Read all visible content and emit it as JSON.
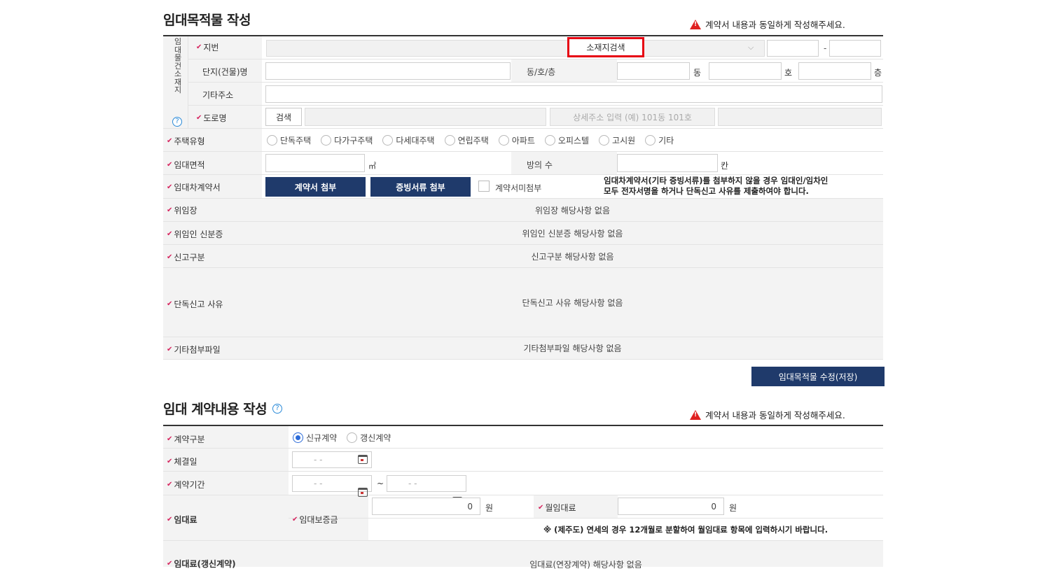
{
  "section1": {
    "title": "임대목적물 작성",
    "warning": "계약서 내용과 동일하게 작성해주세요.",
    "vertical_label": [
      "임",
      "대",
      "물",
      "건",
      "소",
      "재",
      "지"
    ],
    "jibun": {
      "label": "지번",
      "search_btn": "소재지검색",
      "dash": "-"
    },
    "complex": {
      "label": "단지(건물)명",
      "dong_ho_label": "동/호/층",
      "dong": "동",
      "ho": "호",
      "floor": "층"
    },
    "etc_address": {
      "label": "기타주소"
    },
    "road": {
      "label": "도로명",
      "search_btn": "검색",
      "detail_placeholder": "상세주소 입력 (예) 101동 101호"
    },
    "house_type": {
      "label": "주택유형",
      "options": [
        "단독주택",
        "다가구주택",
        "다세대주택",
        "연립주택",
        "아파트",
        "오피스텔",
        "고시원",
        "기타"
      ]
    },
    "area": {
      "label": "임대면적",
      "unit": "㎡",
      "rooms_label": "방의 수",
      "rooms_unit": "칸"
    },
    "contract": {
      "label": "임대차계약서",
      "attach_btn": "계약서 첨부",
      "evidence_btn": "증빙서류 첨부",
      "no_attach": "계약서미첨부",
      "notice_line1": "임대차계약서(기타 증빙서류)를 첨부하지 않을 경우 임대인/임차인",
      "notice_line2": "모두 전자서명을 하거나 단독신고 사유를 제출하여야 합니다."
    },
    "proxy": {
      "label": "위임장",
      "value": "위임장 해당사항 없음"
    },
    "proxy_id": {
      "label": "위임인 신분증",
      "value": "위임인 신분증 해당사항 없음"
    },
    "report_type": {
      "label": "신고구분",
      "value": "신고구분 해당사항 없음"
    },
    "solo_reason": {
      "label": "단독신고 사유",
      "value": "단독신고 사유 해당사항 없음"
    },
    "other_files": {
      "label": "기타첨부파일",
      "value": "기타첨부파일 해당사항 없음"
    },
    "save_btn": "임대목적물 수정(저장)"
  },
  "section2": {
    "title": "임대 계약내용 작성",
    "warning": "계약서 내용과 동일하게 작성해주세요.",
    "contract_type": {
      "label": "계약구분",
      "options": [
        "신규계약",
        "갱신계약"
      ],
      "selected": "신규계약"
    },
    "sign_date": {
      "label": "체결일",
      "placeholder": "-  -"
    },
    "period": {
      "label": "계약기간",
      "start": "-  -",
      "tilde": "~",
      "end": "-  -"
    },
    "rent": {
      "label": "임대료",
      "deposit_label": "임대보증금",
      "deposit_value": "0",
      "won": "원",
      "monthly_label": "월임대료",
      "monthly_value": "0",
      "note": "※ (제주도) 연세의 경우 12개월로 분할하여 월임대료 항목에 입력하시기 바랍니다."
    },
    "renew_rent": {
      "label": "임대료(갱신계약)",
      "value": "임대료(연장계약) 해당사항 없음"
    }
  }
}
